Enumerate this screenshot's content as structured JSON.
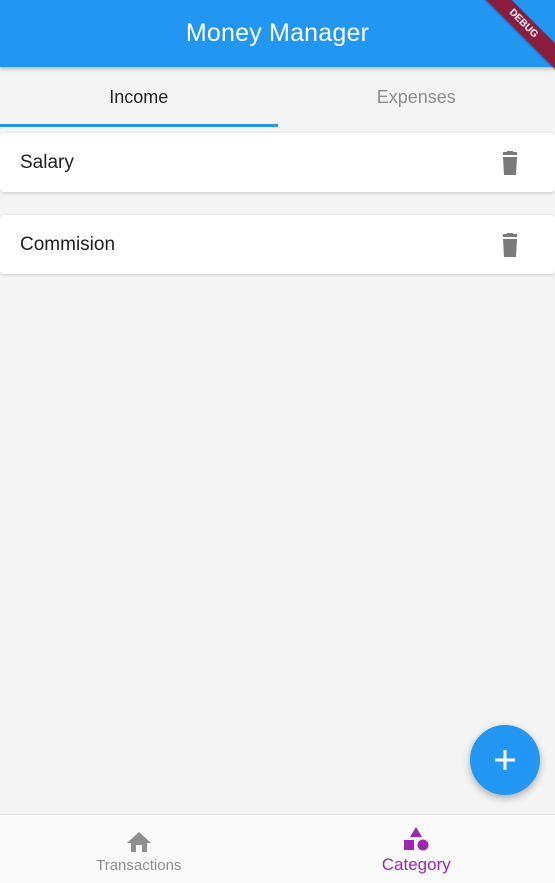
{
  "app_bar": {
    "title": "Money Manager"
  },
  "debug_banner": {
    "label": "DEBUG"
  },
  "tabs": [
    {
      "label": "Income",
      "active": true
    },
    {
      "label": "Expenses",
      "active": false
    }
  ],
  "categories": [
    {
      "label": "Salary",
      "action_icon": "delete-icon"
    },
    {
      "label": "Commision",
      "action_icon": "delete-icon"
    }
  ],
  "fab": {
    "icon": "add-icon"
  },
  "bottom_nav": {
    "items": [
      {
        "label": "Transactions",
        "icon": "home-icon",
        "active": false
      },
      {
        "label": "Category",
        "icon": "category-icon",
        "active": true
      }
    ]
  },
  "colors": {
    "primary": "#2196f3",
    "accent": "#9c27b0",
    "inactive": "#8e8e8e",
    "debug_banner": "#8b1e3f"
  }
}
